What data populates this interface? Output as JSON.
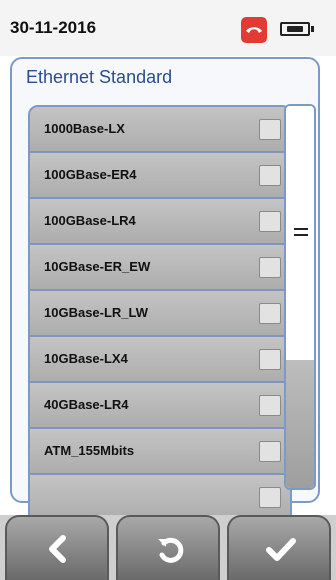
{
  "status": {
    "date": "30-11-2016",
    "icons": [
      "phone-hangup-icon",
      "battery-icon"
    ],
    "colors": {
      "phone": "#e23b35"
    }
  },
  "panel": {
    "title": "Ethernet Standard",
    "items": [
      {
        "label": "1000Base-LX",
        "checked": false
      },
      {
        "label": "100GBase-ER4",
        "checked": false
      },
      {
        "label": "100GBase-LR4",
        "checked": false
      },
      {
        "label": "10GBase-ER_EW",
        "checked": false
      },
      {
        "label": "10GBase-LR_LW",
        "checked": false
      },
      {
        "label": "10GBase-LX4",
        "checked": false
      },
      {
        "label": "40GBase-LR4",
        "checked": false
      },
      {
        "label": "ATM_155Mbits",
        "checked": false
      }
    ]
  },
  "toolbar": {
    "buttons": [
      {
        "icon": "chevron-left-icon"
      },
      {
        "icon": "undo-icon"
      },
      {
        "icon": "checkmark-icon"
      }
    ]
  },
  "accent": "#2a4f8a"
}
